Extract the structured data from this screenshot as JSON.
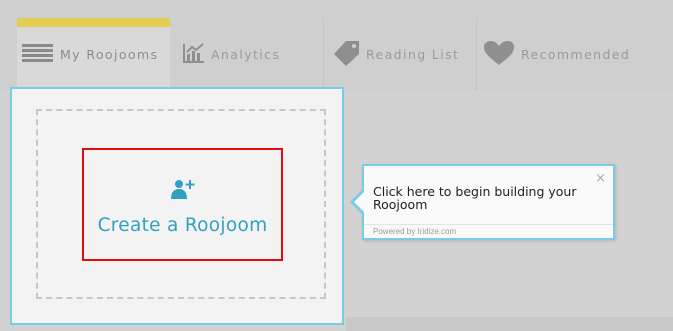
{
  "nav": {
    "tabs": [
      {
        "label": "My Roojooms",
        "icon": "stack-icon",
        "active": true
      },
      {
        "label": "Analytics",
        "icon": "chart-icon",
        "active": false
      },
      {
        "label": "Reading List",
        "icon": "tag-icon",
        "active": false
      },
      {
        "label": "Recommended",
        "icon": "heart-icon",
        "active": false
      }
    ]
  },
  "create": {
    "label": "Create a Roojoom",
    "icon": "add-user-icon"
  },
  "tooltip": {
    "text": "Click here to begin building your Roojoom",
    "close": "×",
    "footer": "Powered by Iridize.com"
  },
  "colors": {
    "accent": "#31a0c2",
    "tab_active_bar": "#e3cd52",
    "highlight_border": "#e10d0d",
    "card_border": "#76cde6"
  }
}
